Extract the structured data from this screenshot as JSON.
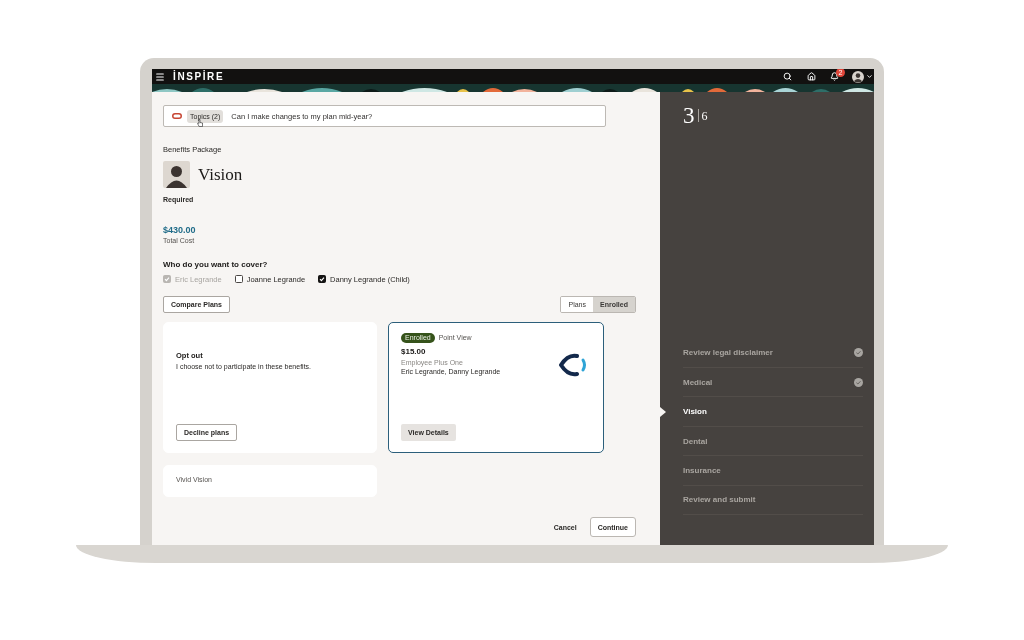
{
  "header": {
    "logo": "İNSPİRE",
    "notification_count": "2"
  },
  "search": {
    "chip": "Topics (2)",
    "value": "Can I make changes to my plan mid-year?"
  },
  "package": {
    "label": "Benefits Package",
    "title": "Vision",
    "requirement": "Required",
    "total_cost": "$430.00",
    "total_cost_label": "Total Cost"
  },
  "coverage": {
    "question": "Who do you want to cover?",
    "members": [
      {
        "name": "Eric Legrande",
        "checked": true,
        "disabled": true
      },
      {
        "name": "Joanne Legrande",
        "checked": false,
        "disabled": false
      },
      {
        "name": "Danny Legrande (Child)",
        "checked": true,
        "disabled": false
      }
    ]
  },
  "compare_button": "Compare Plans",
  "view_toggle": [
    {
      "label": "Plans",
      "selected": false
    },
    {
      "label": "Enrolled",
      "selected": true
    }
  ],
  "cards": [
    {
      "kind": "opt_out",
      "title": "Opt out",
      "description": "I choose not to participate in these benefits.",
      "button": "Decline plans",
      "selected": false
    },
    {
      "kind": "plan",
      "badge": "Enrolled",
      "name": "Point View",
      "price": "$15.00",
      "tier": "Employee Plus One",
      "covered": "Eric Legrande, Danny Legrande",
      "button": "View Details",
      "selected": true
    },
    {
      "kind": "plan",
      "name": "Vivid Vision",
      "selected": false
    }
  ],
  "footer": {
    "cancel": "Cancel",
    "continue": "Continue"
  },
  "progress": {
    "current": "3",
    "total": "6"
  },
  "steps": [
    {
      "label": "Review legal disclaimer",
      "completed": true,
      "selected": false
    },
    {
      "label": "Medical",
      "completed": true,
      "selected": false
    },
    {
      "label": "Vision",
      "completed": false,
      "selected": true
    },
    {
      "label": "Dental",
      "completed": false,
      "selected": false
    },
    {
      "label": "Insurance",
      "completed": false,
      "selected": false
    },
    {
      "label": "Review and submit",
      "completed": false,
      "selected": false
    }
  ]
}
